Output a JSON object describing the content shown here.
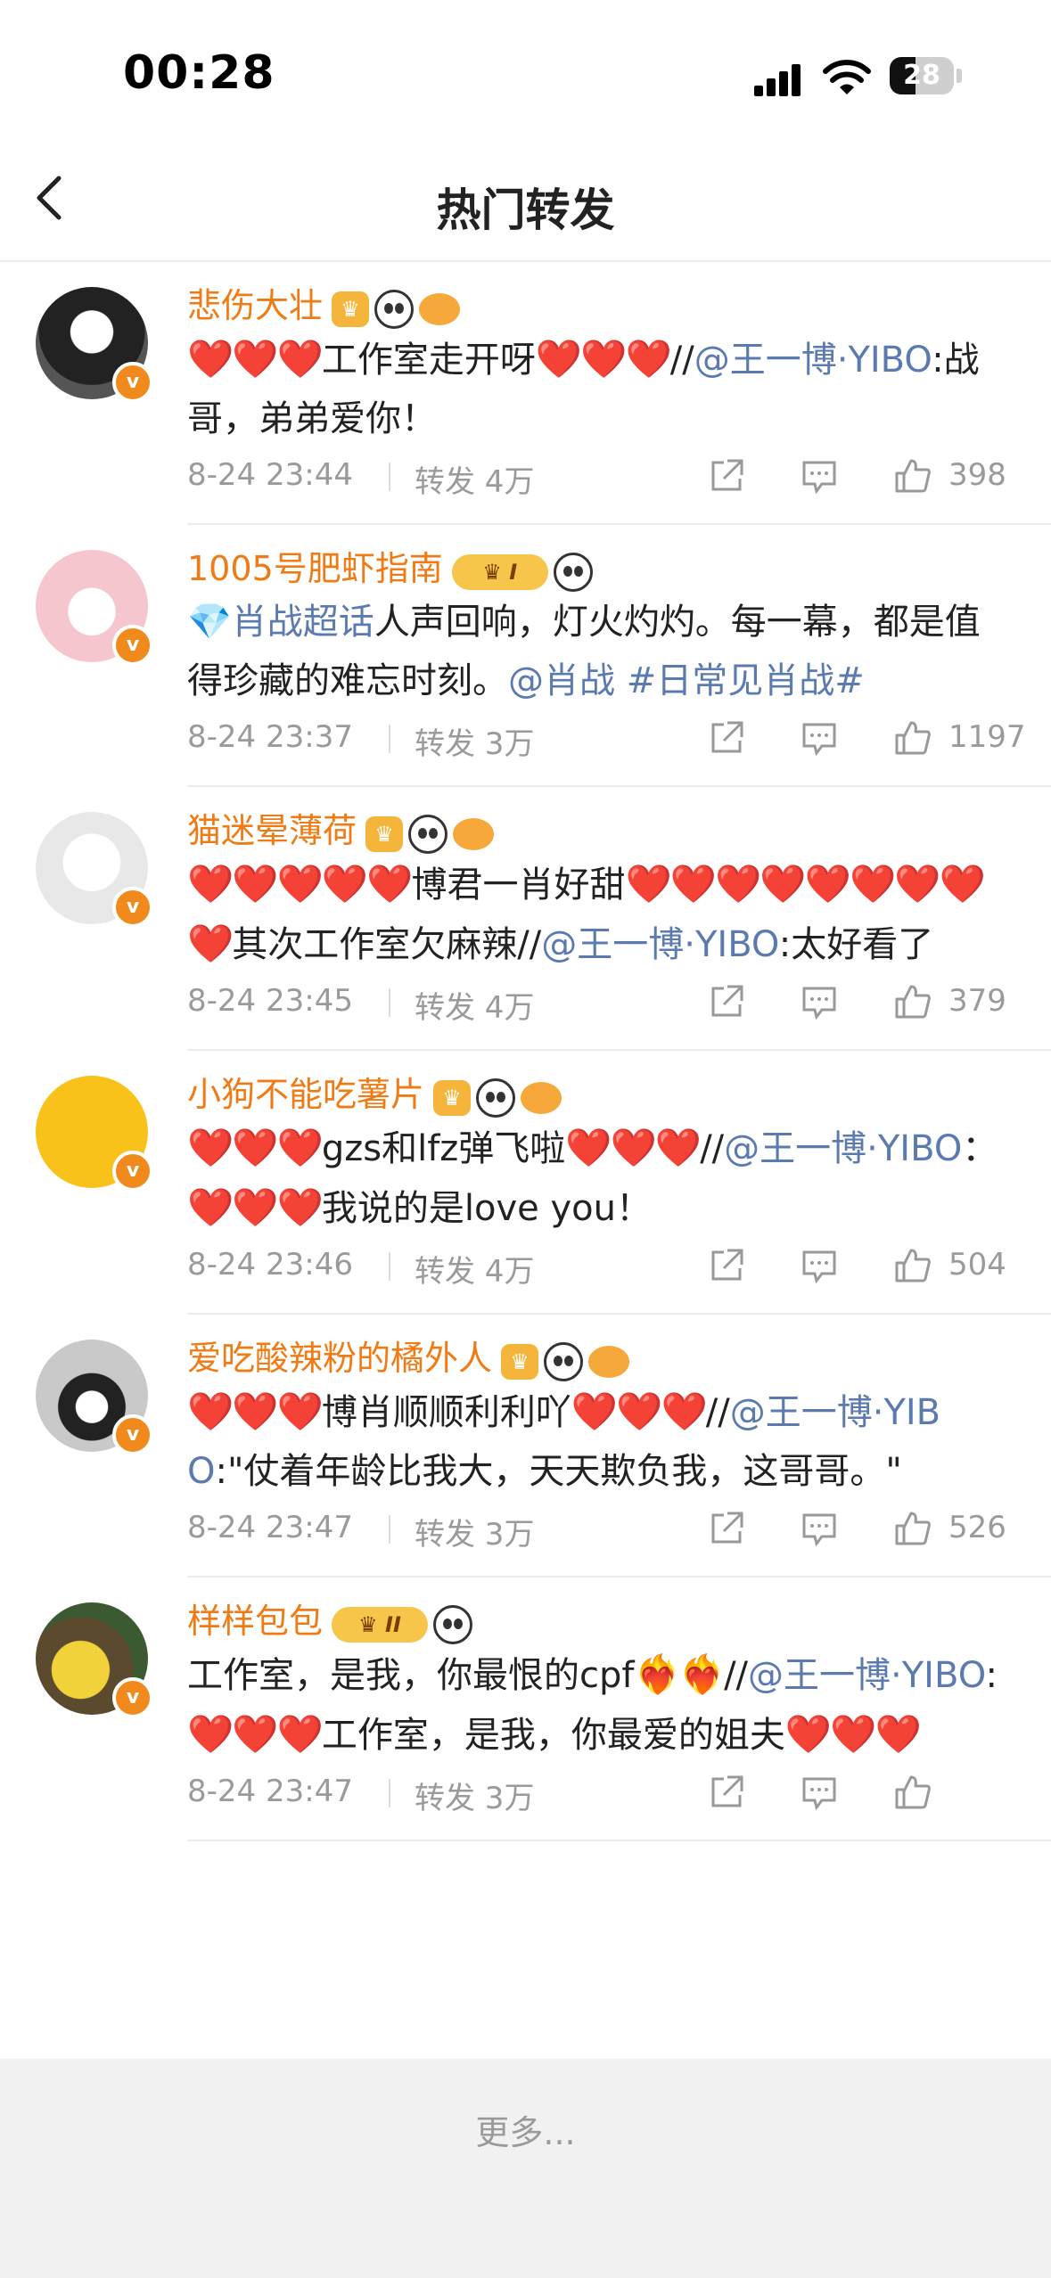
{
  "status": {
    "time": "00:28",
    "battery": "28"
  },
  "nav": {
    "title": "热门转发"
  },
  "items": [
    {
      "name": "悲伤大壮",
      "badges": [
        "crown",
        "panda",
        "fish"
      ],
      "content": [
        [
          "h",
          "❤️❤️❤️"
        ],
        [
          "t",
          "工作室走开呀"
        ],
        [
          "h",
          "❤️❤️❤️"
        ],
        [
          "t",
          "//"
        ],
        [
          "l",
          "@王一博·YIBO"
        ],
        [
          "t",
          ":战哥，弟弟爱你！"
        ]
      ],
      "time": "8-24 23:44",
      "repost": "转发 4万",
      "likes": "398"
    },
    {
      "name": "1005号肥虾指南",
      "badges": [
        "crownlv",
        "panda"
      ],
      "level": "I",
      "content": [
        [
          "l",
          "💎肖战超话"
        ],
        [
          "t",
          "人声回响，灯火灼灼。每一幕，都是值得珍藏的难忘时刻。"
        ],
        [
          "l",
          "@肖战 #日常见肖战#"
        ]
      ],
      "time": "8-24 23:37",
      "repost": "转发 3万",
      "likes": "1197"
    },
    {
      "name": "猫迷晕薄荷",
      "badges": [
        "crown",
        "panda",
        "fish"
      ],
      "content": [
        [
          "h",
          "❤️❤️❤️❤️❤️"
        ],
        [
          "t",
          "博君一肖好甜"
        ],
        [
          "h",
          "❤️❤️❤️❤️❤️❤️❤️❤️❤️"
        ],
        [
          "t",
          "其次工作室欠麻辣//"
        ],
        [
          "l",
          "@王一博·YIBO"
        ],
        [
          "t",
          ":太好看了"
        ]
      ],
      "time": "8-24 23:45",
      "repost": "转发 4万",
      "likes": "379"
    },
    {
      "name": "小狗不能吃薯片",
      "badges": [
        "crown",
        "panda",
        "fish"
      ],
      "content": [
        [
          "h",
          "❤️❤️❤️"
        ],
        [
          "t",
          "gzs和lfz弹飞啦"
        ],
        [
          "h",
          "❤️❤️❤️"
        ],
        [
          "t",
          "//"
        ],
        [
          "l",
          "@王一博·YIBO"
        ],
        [
          "t",
          "： "
        ],
        [
          "h",
          "❤️❤️❤️"
        ],
        [
          "t",
          "我说的是love you！"
        ]
      ],
      "time": "8-24 23:46",
      "repost": "转发 4万",
      "likes": "504"
    },
    {
      "name": "爱吃酸辣粉的橘外人",
      "badges": [
        "crown",
        "panda",
        "fish"
      ],
      "content": [
        [
          "h",
          "❤️❤️❤️"
        ],
        [
          "t",
          "博肖顺顺利利吖"
        ],
        [
          "h",
          "❤️❤️❤️"
        ],
        [
          "t",
          "//"
        ],
        [
          "l",
          "@王一博·YIBO"
        ],
        [
          "t",
          ":\"仗着年龄比我大，天天欺负我，这哥哥。\""
        ]
      ],
      "time": "8-24 23:47",
      "repost": "转发 3万",
      "likes": "526"
    },
    {
      "name": "样样包包",
      "badges": [
        "crownlv",
        "panda"
      ],
      "level": "II",
      "content": [
        [
          "t",
          "工作室，是我，你最恨的cpf"
        ],
        [
          "h",
          "❤️‍🔥❤️‍🔥"
        ],
        [
          "t",
          "//"
        ],
        [
          "l",
          "@王一博·YIBO"
        ],
        [
          "t",
          ":"
        ],
        [
          "h",
          "❤️❤️❤️"
        ],
        [
          "t",
          "工作室，是我，你最爱的姐夫"
        ],
        [
          "h",
          "❤️❤️❤️"
        ]
      ],
      "time": "8-24 23:47",
      "repost": "转发 3万",
      "likes": ""
    }
  ],
  "footer": {
    "more": "更多..."
  },
  "colors": {
    "username": "#f07b15",
    "link": "#5b7ab0",
    "heart": "#e5262a",
    "meta": "#9a9a9a"
  }
}
